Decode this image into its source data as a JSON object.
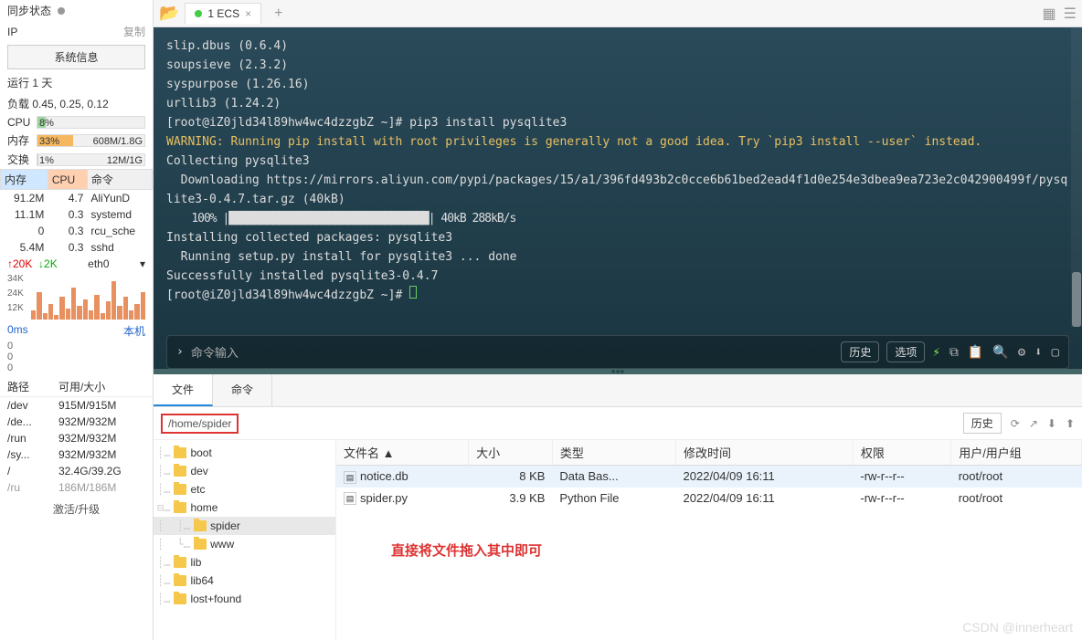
{
  "sidebar": {
    "sync_label": "同步状态",
    "ip_label": "IP",
    "copy": "复制",
    "sysinfo_btn": "系统信息",
    "uptime": "运行 1 天",
    "load": "负载 0.45, 0.25, 0.12",
    "cpu_label": "CPU",
    "cpu_pct": "8%",
    "mem_label": "内存",
    "mem_pct": "33%",
    "mem_val": "608M/1.8G",
    "swap_label": "交换",
    "swap_pct": "1%",
    "swap_val": "12M/1G",
    "proc_hdr_mem": "内存",
    "proc_hdr_cpu": "CPU",
    "proc_hdr_cmd": "命令",
    "procs": [
      {
        "mem": "91.2M",
        "cpu": "4.7",
        "cmd": "AliYunD"
      },
      {
        "mem": "11.1M",
        "cpu": "0.3",
        "cmd": "systemd"
      },
      {
        "mem": "0",
        "cpu": "0.3",
        "cmd": "rcu_sche"
      },
      {
        "mem": "5.4M",
        "cpu": "0.3",
        "cmd": "sshd"
      }
    ],
    "net_up": "↑20K",
    "net_down": "↓2K",
    "net_if": "eth0",
    "chart_y": [
      "34K",
      "24K",
      "12K"
    ],
    "lat_label": "0ms",
    "lat_host": "本机",
    "lat_zeros": [
      "0",
      "0",
      "0"
    ],
    "disk_hdr_path": "路径",
    "disk_hdr_size": "可用/大小",
    "disks": [
      {
        "p": "/dev",
        "s": "915M/915M"
      },
      {
        "p": "/de...",
        "s": "932M/932M"
      },
      {
        "p": "/run",
        "s": "932M/932M"
      },
      {
        "p": "/sy...",
        "s": "932M/932M"
      },
      {
        "p": "/",
        "s": "32.4G/39.2G"
      },
      {
        "p": "/ru",
        "s": "186M/186M"
      }
    ],
    "activate": "激活/升级"
  },
  "tabs": {
    "active": "1 ECS"
  },
  "terminal": {
    "lines": [
      {
        "t": "slip.dbus (0.6.4)"
      },
      {
        "t": "soupsieve (2.3.2)"
      },
      {
        "t": "syspurpose (1.26.16)"
      },
      {
        "t": "urllib3 (1.24.2)"
      },
      {
        "t": "[root@iZ0jld34l89hw4wc4dzzgbZ ~]# pip3 install pysqlite3"
      },
      {
        "t": "WARNING: Running pip install with root privileges is generally not a good idea. Try `pip3 install --user` instead.",
        "c": "term-warn"
      },
      {
        "t": "Collecting pysqlite3"
      },
      {
        "t": "  Downloading https://mirrors.aliyun.com/pypi/packages/15/a1/396fd493b2c0cce6b61bed2ead4f1d0e254e3dbea9ea723e2c042900499f/pysqlite3-0.4.7.tar.gz (40kB)"
      },
      {
        "t": "    100% |████████████████████████████████| 40kB 288kB/s",
        "c": "term-progress"
      },
      {
        "t": "Installing collected packages: pysqlite3"
      },
      {
        "t": "  Running setup.py install for pysqlite3 ... done"
      },
      {
        "t": "Successfully installed pysqlite3-0.4.7"
      },
      {
        "t": "[root@iZ0jld34l89hw4wc4dzzgbZ ~]# ",
        "cursor": true
      }
    ],
    "cmd_placeholder": "命令输入",
    "history": "历史",
    "options": "选项"
  },
  "fm": {
    "tab_file": "文件",
    "tab_cmd": "命令",
    "path": "/home/spider",
    "history": "历史",
    "tree": [
      {
        "ind": "┊…",
        "exp": "",
        "n": "boot"
      },
      {
        "ind": "┊…",
        "exp": "",
        "n": "dev"
      },
      {
        "ind": "┊…",
        "exp": "",
        "n": "etc"
      },
      {
        "ind": "⊟…",
        "exp": "",
        "n": "home"
      },
      {
        "ind": "┊  ┊…",
        "exp": "",
        "n": "spider",
        "sel": true
      },
      {
        "ind": "┊  └…",
        "exp": "",
        "n": "www"
      },
      {
        "ind": "┊…",
        "exp": "",
        "n": "lib"
      },
      {
        "ind": "┊…",
        "exp": "",
        "n": "lib64"
      },
      {
        "ind": "┊…",
        "exp": "",
        "n": "lost+found"
      }
    ],
    "cols": {
      "name": "文件名 ▲",
      "size": "大小",
      "type": "类型",
      "mtime": "修改时间",
      "perm": "权限",
      "owner": "用户/用户组"
    },
    "files": [
      {
        "n": "notice.db",
        "s": "8 KB",
        "t": "Data Bas...",
        "m": "2022/04/09 16:11",
        "p": "-rw-r--r--",
        "o": "root/root",
        "sel": true
      },
      {
        "n": "spider.py",
        "s": "3.9 KB",
        "t": "Python File",
        "m": "2022/04/09 16:11",
        "p": "-rw-r--r--",
        "o": "root/root"
      }
    ],
    "drag_hint": "直接将文件拖入其中即可"
  },
  "watermark": "CSDN @innerheart"
}
